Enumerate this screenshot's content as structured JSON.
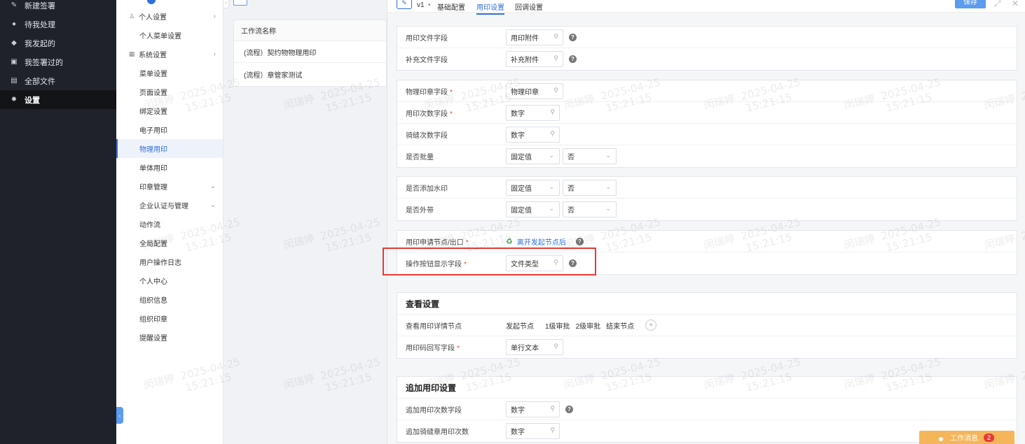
{
  "nav": {
    "items": [
      {
        "label": "新建签署",
        "icon": "pen-icon"
      },
      {
        "label": "待我处理",
        "icon": "user-icon"
      },
      {
        "label": "我发起的",
        "icon": "users-icon"
      },
      {
        "label": "我签署过的",
        "icon": "document-icon"
      },
      {
        "label": "全部文件",
        "icon": "file-icon"
      },
      {
        "label": "设置",
        "icon": "gear-icon",
        "active": true
      }
    ]
  },
  "submenu": {
    "items": [
      {
        "label": "个人设置",
        "group": true
      },
      {
        "label": "个人菜单设置"
      },
      {
        "label": "系统设置",
        "group": true
      },
      {
        "label": "菜单设置"
      },
      {
        "label": "页面设置"
      },
      {
        "label": "绑定设置"
      },
      {
        "label": "电子用印"
      },
      {
        "label": "物理用印",
        "active": true
      },
      {
        "label": "单体用印"
      },
      {
        "label": "印章管理"
      },
      {
        "label": "企业认证与管理"
      },
      {
        "label": "动作流"
      },
      {
        "label": "全局配置"
      },
      {
        "label": "用户操作日志"
      },
      {
        "label": "个人中心"
      },
      {
        "label": "组织信息"
      },
      {
        "label": "组织印章"
      },
      {
        "label": "提醒设置"
      }
    ]
  },
  "workflow": {
    "header": "工作流名称",
    "rows": [
      "(流程）契约物物理用印",
      "(流程）章管家测试"
    ]
  },
  "topbar": {
    "version": "v1",
    "tabs": [
      "基础配置",
      "用印设置",
      "回调设置"
    ],
    "active_tab": "用印设置",
    "save": "保存"
  },
  "form": {
    "file_field_label": "用印文件字段",
    "file_field_value": "用印附件",
    "extra_file_label": "补充文件字段",
    "extra_file_value": "补充附件",
    "seal_field_label": "物理印章字段",
    "seal_field_value": "物理印章",
    "count_field_label": "用印次数字段",
    "count_field_value": "数字",
    "ride_count_label": "骑缝次数字段",
    "ride_count_value": "数字",
    "batch_label": "是否批量",
    "batch_type": "固定值",
    "batch_value": "否",
    "watermark_label": "是否添加水印",
    "watermark_type": "固定值",
    "watermark_value": "否",
    "carry_out_label": "是否外带",
    "carry_out_type": "固定值",
    "carry_out_value": "否",
    "apply_node_label": "用印申请节点/出口",
    "apply_node_value": "离开发起节点后",
    "button_field_label": "操作按钮显示字段",
    "button_field_value": "文件类型"
  },
  "view": {
    "title": "查看设置",
    "detail_nodes_label": "查看用印详情节点",
    "nodes": [
      "发起节点",
      "1级审批",
      "2级审批",
      "结束节点"
    ],
    "writeback_label": "用印码回写字段",
    "writeback_value": "单行文本"
  },
  "append": {
    "title": "追加用印设置",
    "count_label": "追加用印次数字段",
    "count_value": "数字",
    "ride_label": "追加骑缝章用印次数",
    "ride_value": "数字"
  },
  "message": {
    "label": "工作消息",
    "badge": "2"
  },
  "watermark": {
    "name": "闵瑞婷",
    "date": "2025-04-25",
    "time": "15:21:15"
  },
  "colors": {
    "accent": "#2f6fdc",
    "nav_bg": "#1f2329",
    "highlight": "#e53935",
    "message_bg": "#f5b55a"
  }
}
